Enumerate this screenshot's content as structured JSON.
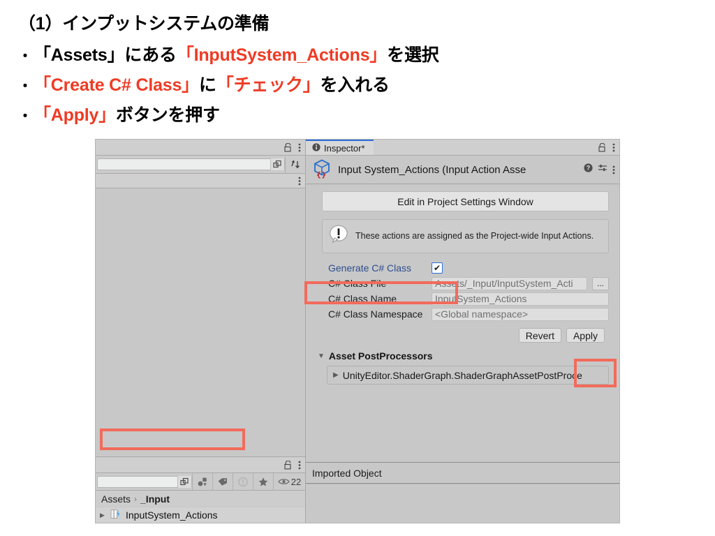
{
  "slide": {
    "title": "（1）インプットシステムの準備",
    "bullets": [
      {
        "marker": "・",
        "segments": [
          {
            "text": "「Assets」にある",
            "color": "black"
          },
          {
            "text": "「InputSystem_Actions」",
            "color": "red"
          },
          {
            "text": "を選択",
            "color": "black"
          }
        ]
      },
      {
        "marker": "・",
        "segments": [
          {
            "text": "「Create C# Class」",
            "color": "red"
          },
          {
            "text": "に",
            "color": "black"
          },
          {
            "text": "「チェック」",
            "color": "red"
          },
          {
            "text": "を入れる",
            "color": "black"
          }
        ]
      },
      {
        "marker": "・",
        "segments": [
          {
            "text": "「Apply」",
            "color": "red"
          },
          {
            "text": "ボタンを押す",
            "color": "black"
          }
        ]
      }
    ],
    "accent_color": "#ef3b24",
    "annotation_color": "#f26b5b"
  },
  "project_window": {
    "search_value": "",
    "breadcrumb": {
      "root": "Assets",
      "separator": "›",
      "current": "_Input"
    },
    "visible_count": "22",
    "assets": [
      {
        "name": "InputSystem_Actions",
        "selected": true
      }
    ]
  },
  "inspector": {
    "tab_label": "Inspector*",
    "tab_accent": "#2c6fd8",
    "object_title": "Input System_Actions (Input Action Asse",
    "edit_button": "Edit in Project Settings Window",
    "help_message": "These actions are assigned as the Project-wide Input Actions.",
    "fields": [
      {
        "label": "Generate C# Class",
        "type": "checkbox",
        "checked": true,
        "override": true,
        "check_glyph": "✔"
      },
      {
        "label": "C# Class File",
        "type": "text",
        "value": "Assets/_Input/InputSystem_Acti",
        "has_browse": true,
        "browse_label": "..."
      },
      {
        "label": "C# Class Name",
        "type": "text",
        "value": "InputSystem_Actions",
        "has_browse": false
      },
      {
        "label": "C# Class Namespace",
        "type": "text",
        "value": "<Global namespace>",
        "has_browse": false
      }
    ],
    "revert_label": "Revert",
    "apply_label": "Apply",
    "postprocessors": {
      "header": "Asset PostProcessors",
      "items": [
        "UnityEditor.ShaderGraph.ShaderGraphAssetPostProce"
      ]
    },
    "imported_object_label": "Imported Object"
  },
  "colors": {
    "panel_bg": "#c8c8c8",
    "toolbar_bg": "#cbcbcb",
    "field_bg": "#dedede",
    "override_label": "#2d4e8e"
  }
}
